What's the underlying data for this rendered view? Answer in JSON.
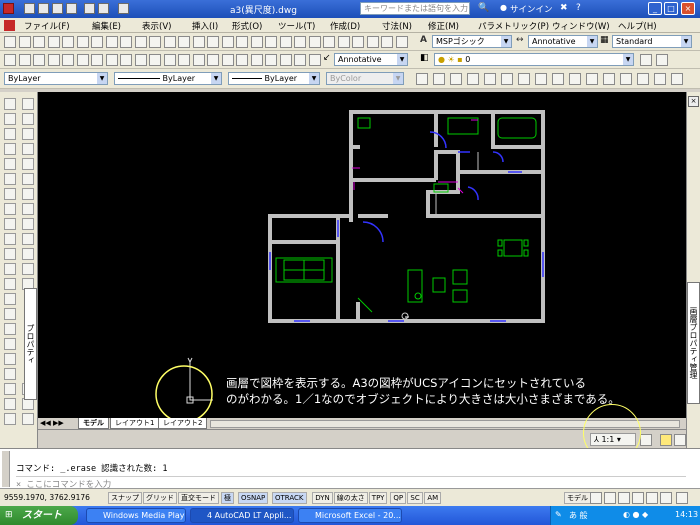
{
  "titlebar": {
    "filename": "a3(異尺度).dwg",
    "search_placeholder": "キーワードまたは語句を入力",
    "signin": "サインイン"
  },
  "menu": [
    "ファイル(F)",
    "編集(E)",
    "表示(V)",
    "挿入(I)",
    "形式(O)",
    "ツール(T)",
    "作成(D)",
    "寸法(N)",
    "修正(M)",
    "パラメトリック(P)",
    "ウィンドウ(W)",
    "ヘルプ(H)"
  ],
  "styles": {
    "text_style": "MSPゴシック",
    "dim_style": "Annotative",
    "table_style": "Standard",
    "multileader_style": "Annotative"
  },
  "layer_current": "0",
  "properties": {
    "color": "ByLayer",
    "linetype": "ByLayer",
    "lineweight": "ByLayer",
    "plotstyle": "ByColor"
  },
  "right_palette_label": "画層プロパティ管理",
  "left_palette_label": "プロパティ",
  "tabs": [
    "モデル",
    "レイアウト1",
    "レイアウト2"
  ],
  "annotation_scale": "1:1",
  "annotation": {
    "line1": "画層で図枠を表示する。A3の図枠がUCSアイコンにセットされている",
    "line2": "のがわかる。1／1なのでオブジェクトにより大きさは大小さまざまである。"
  },
  "command": {
    "history": "コマンド: _.erase 認識された数: 1",
    "prompt": "ここにコマンドを入力"
  },
  "coords": "9559.1970, 3762.9176",
  "status_buttons": [
    "スナップ",
    "グリッド",
    "直交モード",
    "極",
    "OSNAP",
    "OTRACK",
    "DYN",
    "線の太さ",
    "TPY",
    "QP",
    "SC",
    "AM"
  ],
  "status_right": "モデル",
  "taskbar": {
    "start": "スタート",
    "tasks": [
      "Windows Media Player",
      "4 AutoCAD LT Appli...",
      "Microsoft Excel - 20..."
    ],
    "clock": "14:13",
    "ime": "あ 般"
  },
  "colors": {
    "wall": "#c0c0c0",
    "furniture": "#00cc00",
    "door": "#2222ff",
    "dim": "#cc00cc",
    "highlight": "#ffff66"
  }
}
